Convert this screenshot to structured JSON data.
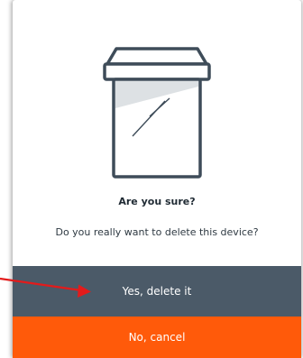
{
  "dialog": {
    "title": "Are you sure?",
    "message": "Do you really want to delete this device?",
    "confirm_label": "Yes, delete it",
    "cancel_label": "No, cancel",
    "illustration_icon": "device-box-icon"
  },
  "colors": {
    "confirm_bg": "#4b5a68",
    "cancel_bg": "#ff5a0a",
    "annotation_arrow": "#e31b1b",
    "icon_stroke": "#3e4c59"
  }
}
